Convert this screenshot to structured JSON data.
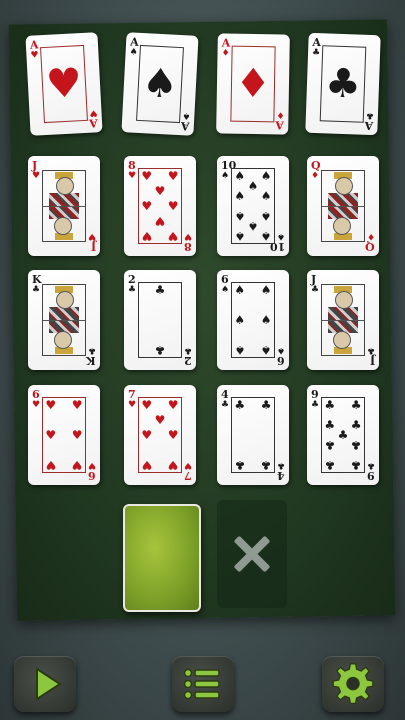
{
  "board": {
    "rows": [
      [
        {
          "rank": "A",
          "suit": "♥",
          "color": "#c4151c"
        },
        {
          "rank": "A",
          "suit": "♠",
          "color": "#1a1a1a"
        },
        {
          "rank": "A",
          "suit": "♦",
          "color": "#c4151c"
        },
        {
          "rank": "A",
          "suit": "♣",
          "color": "#1a1a1a"
        }
      ],
      [
        {
          "rank": "J",
          "suit": "♥",
          "color": "#c4151c"
        },
        {
          "rank": "8",
          "suit": "♥",
          "color": "#c4151c"
        },
        {
          "rank": "10",
          "suit": "♠",
          "color": "#1a1a1a"
        },
        {
          "rank": "Q",
          "suit": "♦",
          "color": "#c4151c"
        }
      ],
      [
        {
          "rank": "K",
          "suit": "♣",
          "color": "#1a1a1a"
        },
        {
          "rank": "2",
          "suit": "♣",
          "color": "#1a1a1a"
        },
        {
          "rank": "6",
          "suit": "♠",
          "color": "#1a1a1a"
        },
        {
          "rank": "J",
          "suit": "♣",
          "color": "#1a1a1a"
        }
      ],
      [
        {
          "rank": "6",
          "suit": "♥",
          "color": "#c4151c"
        },
        {
          "rank": "7",
          "suit": "♥",
          "color": "#c4151c"
        },
        {
          "rank": "4",
          "suit": "♣",
          "color": "#1a1a1a"
        },
        {
          "rank": "9",
          "suit": "♣",
          "color": "#1a1a1a"
        }
      ]
    ]
  },
  "stock": {
    "back_color": "#8db235"
  },
  "discard": {
    "icon": "close-icon"
  },
  "toolbar": {
    "play_icon": "play-icon",
    "menu_icon": "menu-icon",
    "settings_icon": "gear-icon",
    "accent": "#8dc63f"
  }
}
